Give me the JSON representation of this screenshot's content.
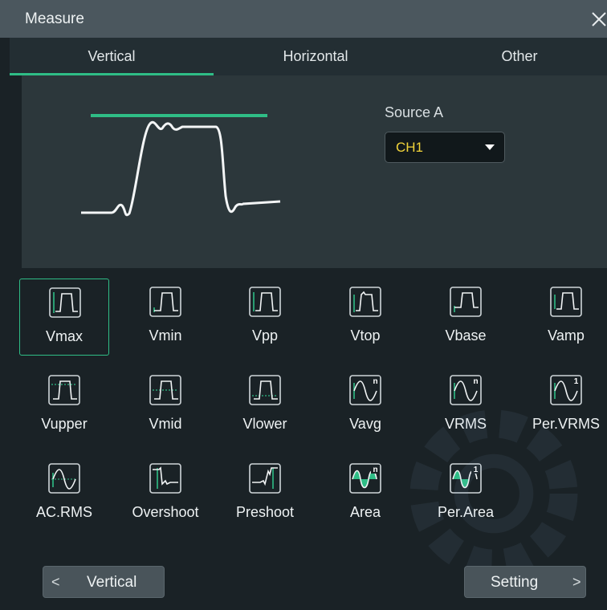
{
  "dialog": {
    "title": "Measure"
  },
  "tabs": [
    {
      "label": "Vertical",
      "active": true
    },
    {
      "label": "Horizontal",
      "active": false
    },
    {
      "label": "Other",
      "active": false
    }
  ],
  "source": {
    "label": "Source A",
    "value": "CH1"
  },
  "items": [
    {
      "label": "Vmax",
      "icon": "vmax-icon",
      "selected": true
    },
    {
      "label": "Vmin",
      "icon": "vmin-icon"
    },
    {
      "label": "Vpp",
      "icon": "vpp-icon"
    },
    {
      "label": "Vtop",
      "icon": "vtop-icon"
    },
    {
      "label": "Vbase",
      "icon": "vbase-icon"
    },
    {
      "label": "Vamp",
      "icon": "vamp-icon"
    },
    {
      "label": "Vupper",
      "icon": "vupper-icon"
    },
    {
      "label": "Vmid",
      "icon": "vmid-icon"
    },
    {
      "label": "Vlower",
      "icon": "vlower-icon"
    },
    {
      "label": "Vavg",
      "icon": "vavg-icon",
      "badge": "n"
    },
    {
      "label": "VRMS",
      "icon": "vrms-icon",
      "badge": "n"
    },
    {
      "label": "Per.VRMS",
      "icon": "per-vrms-icon",
      "badge": "1"
    },
    {
      "label": "AC.RMS",
      "icon": "ac-rms-icon"
    },
    {
      "label": "Overshoot",
      "icon": "overshoot-icon"
    },
    {
      "label": "Preshoot",
      "icon": "preshoot-icon"
    },
    {
      "label": "Area",
      "icon": "area-icon",
      "badge": "n"
    },
    {
      "label": "Per.Area",
      "icon": "per-area-icon",
      "badge": "1"
    }
  ],
  "footer": {
    "left_button": {
      "label": "Vertical",
      "chevron": "<"
    },
    "right_button": {
      "label": "Setting",
      "chevron": ">"
    }
  },
  "colors": {
    "accent": "#2fbd86",
    "source_value": "#f2d43a",
    "background": "#1a2226"
  }
}
